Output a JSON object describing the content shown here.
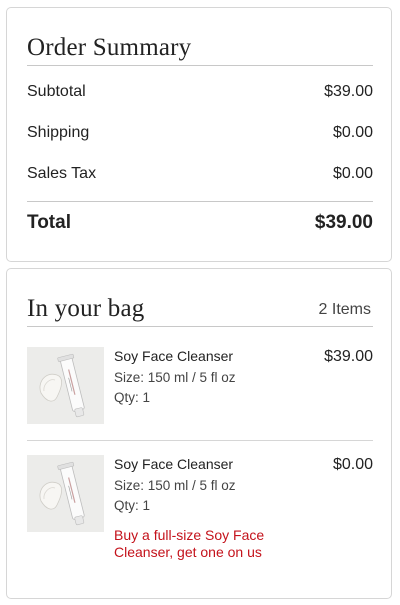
{
  "order_summary": {
    "title": "Order Summary",
    "rows": [
      {
        "label": "Subtotal",
        "value": "$39.00"
      },
      {
        "label": "Shipping",
        "value": "$0.00"
      },
      {
        "label": "Sales Tax",
        "value": "$0.00"
      }
    ],
    "total": {
      "label": "Total",
      "value": "$39.00"
    }
  },
  "bag": {
    "title": "In your bag",
    "count": "2 Items",
    "items": [
      {
        "name": "Soy Face Cleanser",
        "size": "Size: 150 ml / 5 fl oz",
        "qty": "Qty: 1",
        "price": "$39.00",
        "image_icon": "product-tube-image"
      },
      {
        "name": "Soy Face Cleanser",
        "size": "Size: 150 ml / 5 fl oz",
        "qty": "Qty: 1",
        "price": "$0.00",
        "promo": "Buy a full-size Soy Face Cleanser, get one on us",
        "image_icon": "product-tube-image"
      }
    ]
  },
  "colors": {
    "promo": "#c4121b",
    "border": "#d6d6d6",
    "thumb_bg": "#ececea"
  }
}
